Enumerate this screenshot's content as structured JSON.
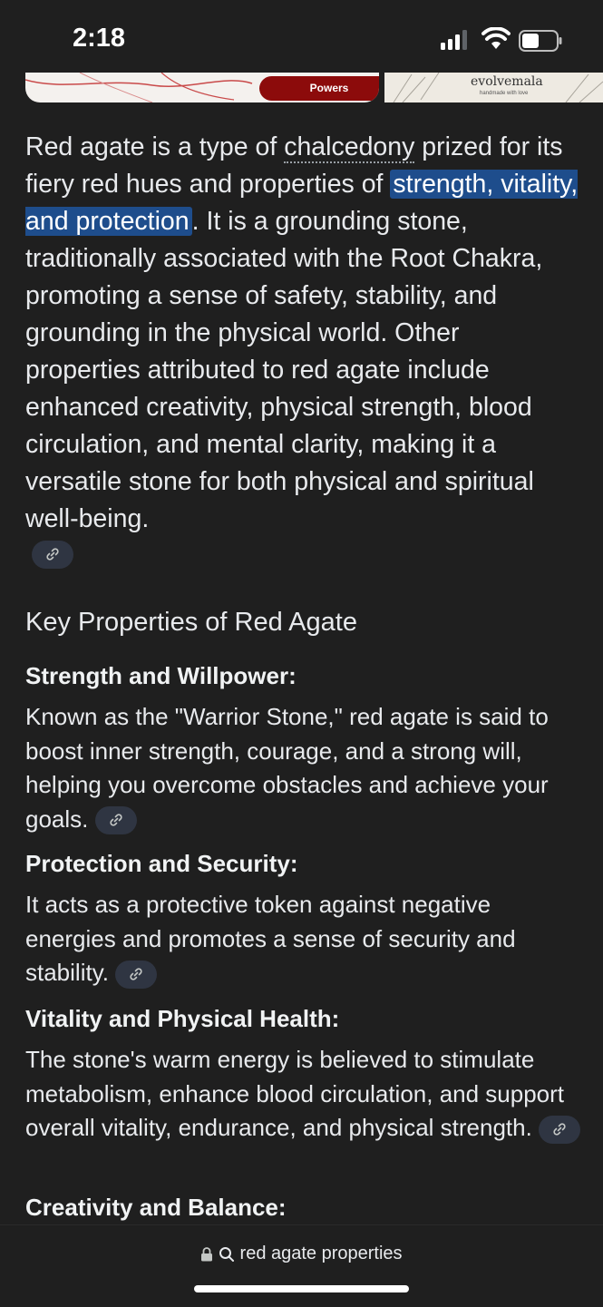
{
  "status": {
    "time": "2:18"
  },
  "banner": {
    "powers_label": "Powers",
    "brand": "evolvemala",
    "brand_tagline": "handmade with love"
  },
  "intro": {
    "p1": "Red agate is a type of ",
    "link": "chalcedony",
    "p2": " prized for its fiery red hues and properties of ",
    "highlight": "strength, vitality, and protection",
    "p3": ". It is a grounding stone, traditionally associated with the Root Chakra, promoting a sense of safety, stability, and grounding in the physical world. Other properties attributed to red agate include enhanced creativity, physical strength, blood circulation, and mental clarity, making it a versatile stone for both physical and spiritual well-being."
  },
  "heading": "Key Properties of Red Agate",
  "sections": [
    {
      "title": "Strength and Willpower:",
      "body": "Known as the \"Warrior Stone,\" red agate is said to boost inner strength, courage, and a strong will, helping you overcome obstacles and achieve your goals. "
    },
    {
      "title": "Protection and Security:",
      "body": "It acts as a protective token against negative energies and promotes a sense of security and stability. "
    },
    {
      "title": "Vitality and Physical Health:",
      "body": "The stone's warm energy is believed to stimulate metabolism, enhance blood circulation, and support overall vitality, endurance, and physical strength. "
    },
    {
      "title": "Creativity and Balance:"
    }
  ],
  "address_bar": {
    "url": "red agate properties"
  },
  "icons": {
    "lock": "lock-icon",
    "search": "search-icon",
    "link": "link-icon"
  }
}
